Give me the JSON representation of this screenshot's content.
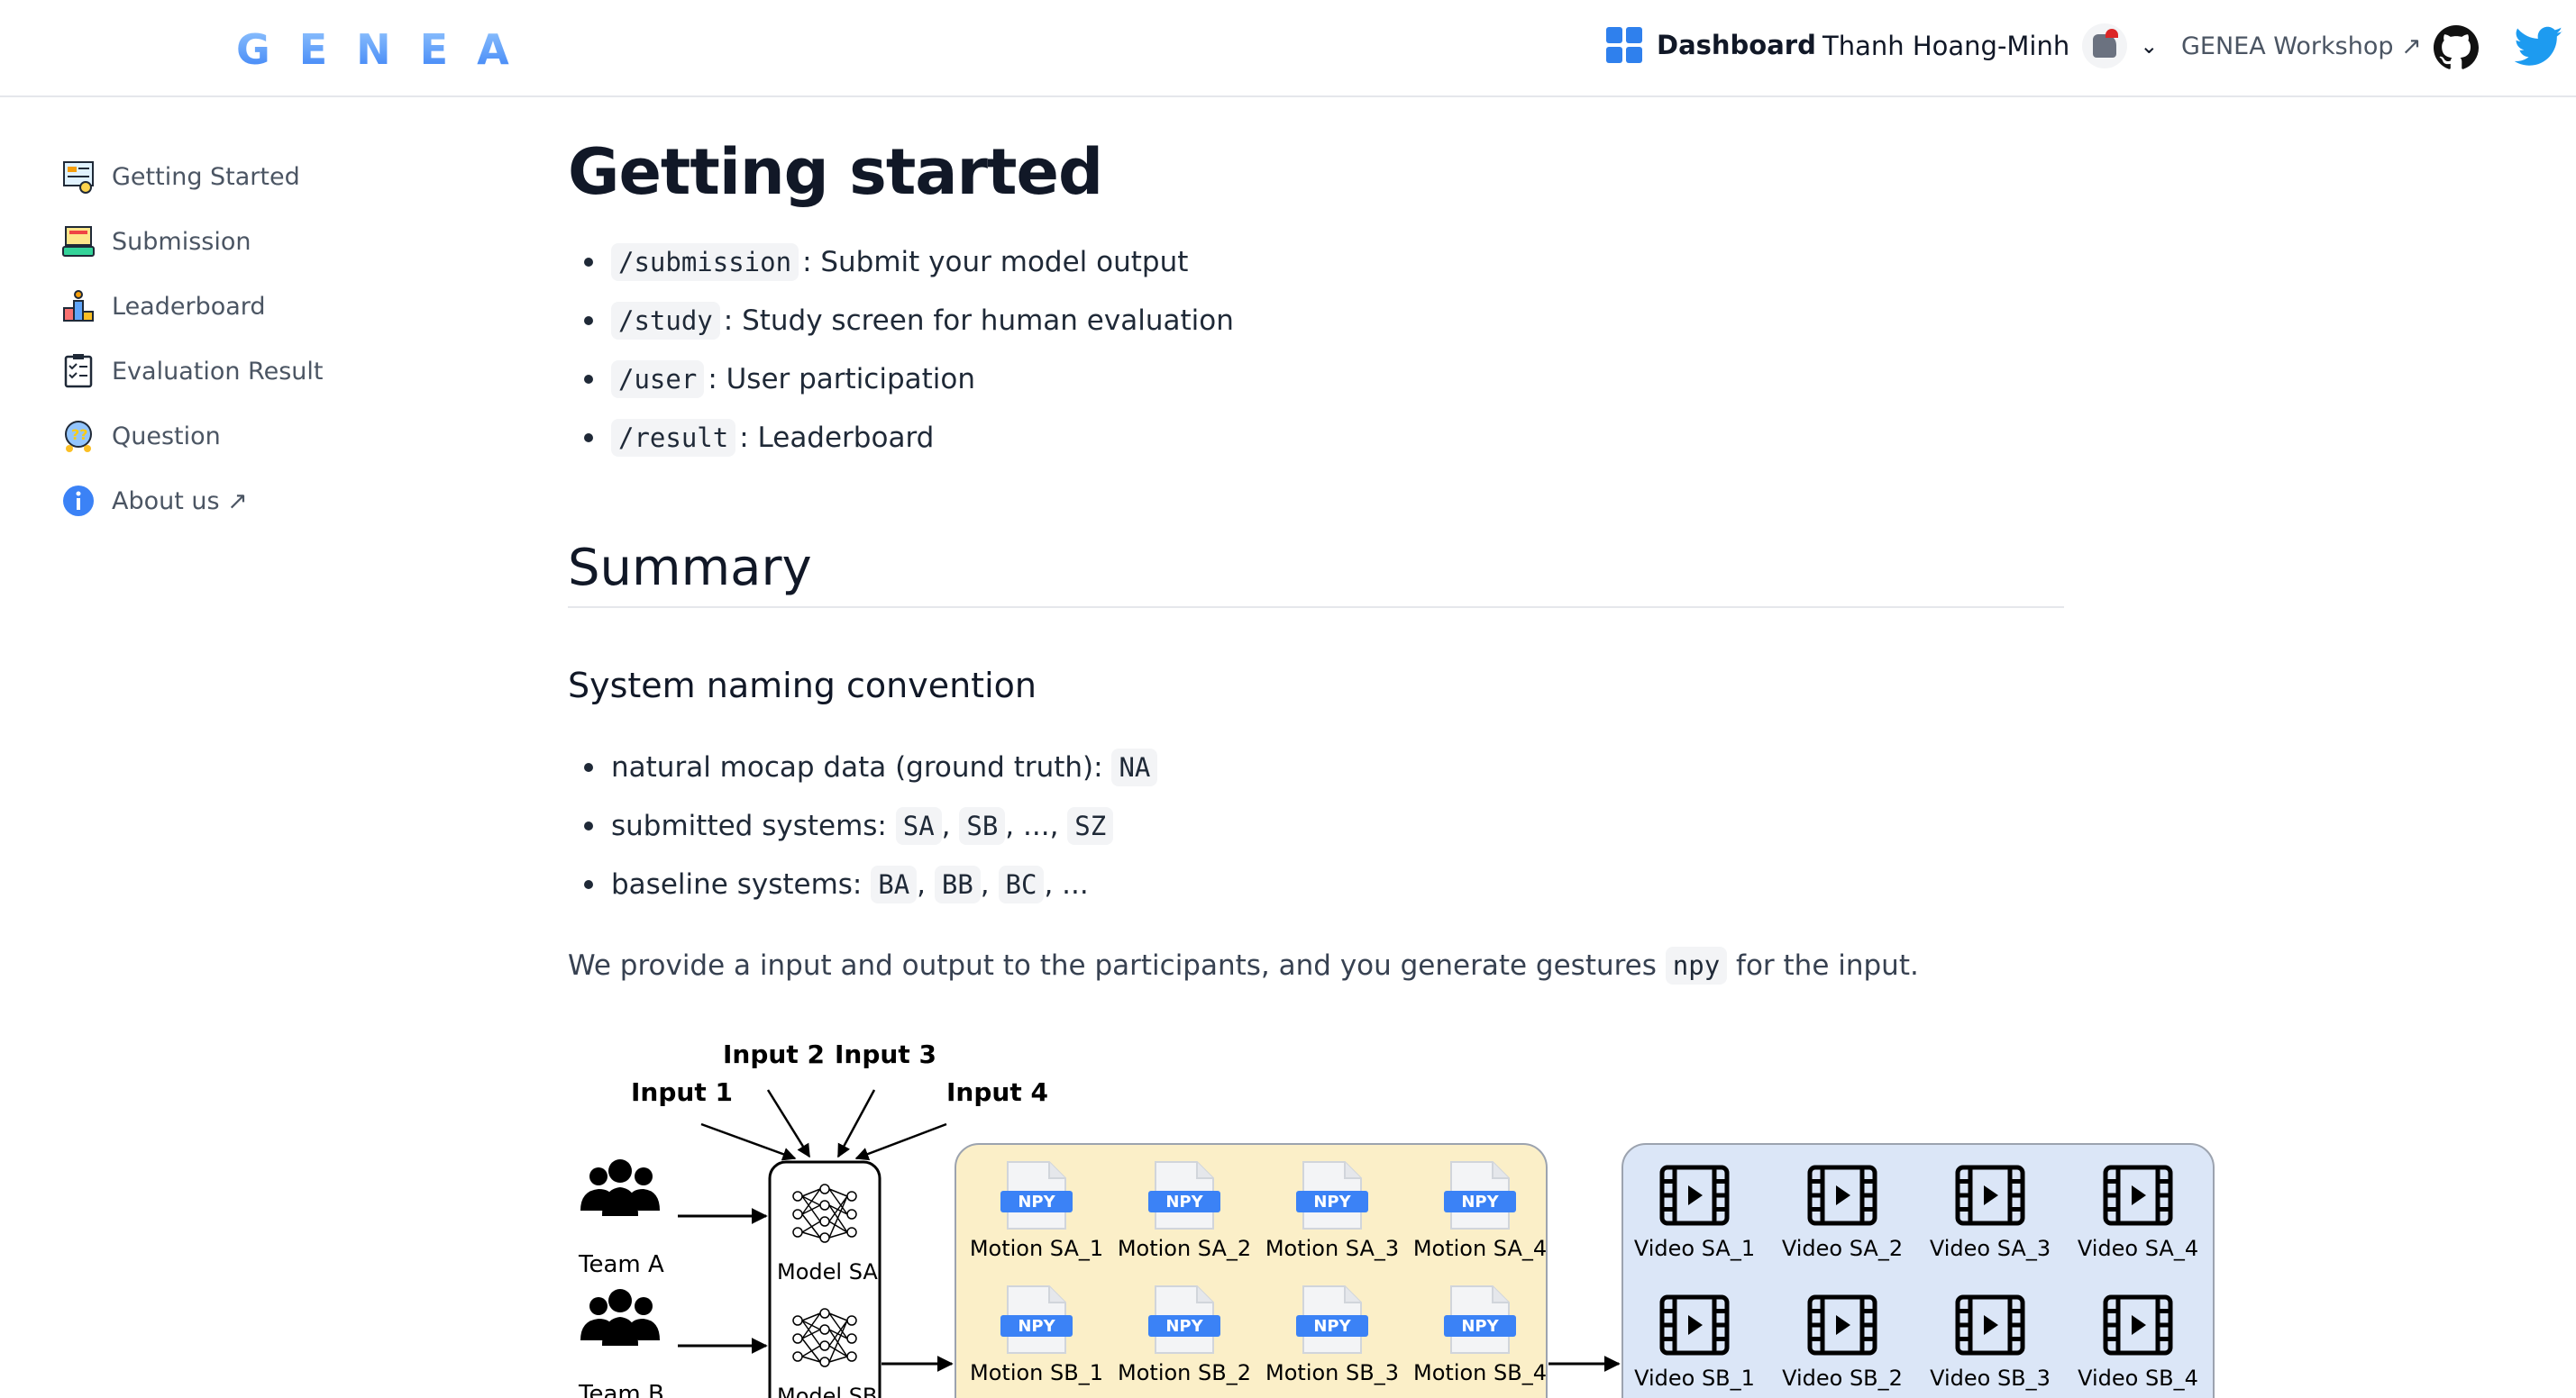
{
  "header": {
    "logo": "GENEA",
    "dashboard_label": "Dashboard",
    "user_name": "Thanh Hoang-Minh",
    "workshop_label": "GENEA Workshop ↗"
  },
  "sidebar": {
    "items": [
      {
        "label": "Getting Started",
        "icon": "getting-started-icon"
      },
      {
        "label": "Submission",
        "icon": "submission-icon"
      },
      {
        "label": "Leaderboard",
        "icon": "leaderboard-icon"
      },
      {
        "label": "Evaluation Result",
        "icon": "evaluation-icon"
      },
      {
        "label": "Question",
        "icon": "question-icon"
      },
      {
        "label": "About us ↗",
        "icon": "info-icon"
      }
    ]
  },
  "main": {
    "title": "Getting started",
    "commands": [
      {
        "code": "/submission",
        "text": ": Submit your model output"
      },
      {
        "code": "/study",
        "text": ": Study screen for human evaluation"
      },
      {
        "code": "/user",
        "text": ": User participation"
      },
      {
        "code": "/result",
        "text": ": Leaderboard"
      }
    ],
    "summary_heading": "Summary",
    "naming_heading": "System naming convention",
    "naming": {
      "natural_label": "natural mocap data (ground truth):",
      "natural_code": "NA",
      "submitted_label": "submitted systems:",
      "submitted_codes": [
        "SA",
        "SB",
        "SZ"
      ],
      "submitted_ellipsis": ", ...,",
      "baseline_label": "baseline systems:",
      "baseline_codes": [
        "BA",
        "BB",
        "BC"
      ],
      "baseline_tail": ", ..."
    },
    "provide_pre": "We provide a input and output to the participants, and you generate gestures",
    "provide_code": "npy",
    "provide_post": "for the input."
  },
  "diagram": {
    "inputs": [
      "Input 1",
      "Input 2",
      "Input 3",
      "Input 4"
    ],
    "teams": [
      "Team A",
      "Team B"
    ],
    "models": [
      "Model SA",
      "Model SB"
    ],
    "npy_badge": "NPY",
    "motions_row1": [
      "Motion SA_1",
      "Motion SA_2",
      "Motion SA_3",
      "Motion SA_4"
    ],
    "motions_row2": [
      "Motion SB_1",
      "Motion SB_2",
      "Motion SB_3",
      "Motion SB_4"
    ],
    "videos_row1": [
      "Video SA_1",
      "Video SA_2",
      "Video SA_3",
      "Video SA_4"
    ],
    "videos_row2": [
      "Video SB_1",
      "Video SB_2",
      "Video SB_3",
      "Video SB_4"
    ],
    "colors": {
      "motion_box": "#fbefc8",
      "video_box": "#dbe6f7",
      "npy_blue": "#3b82f6"
    }
  }
}
